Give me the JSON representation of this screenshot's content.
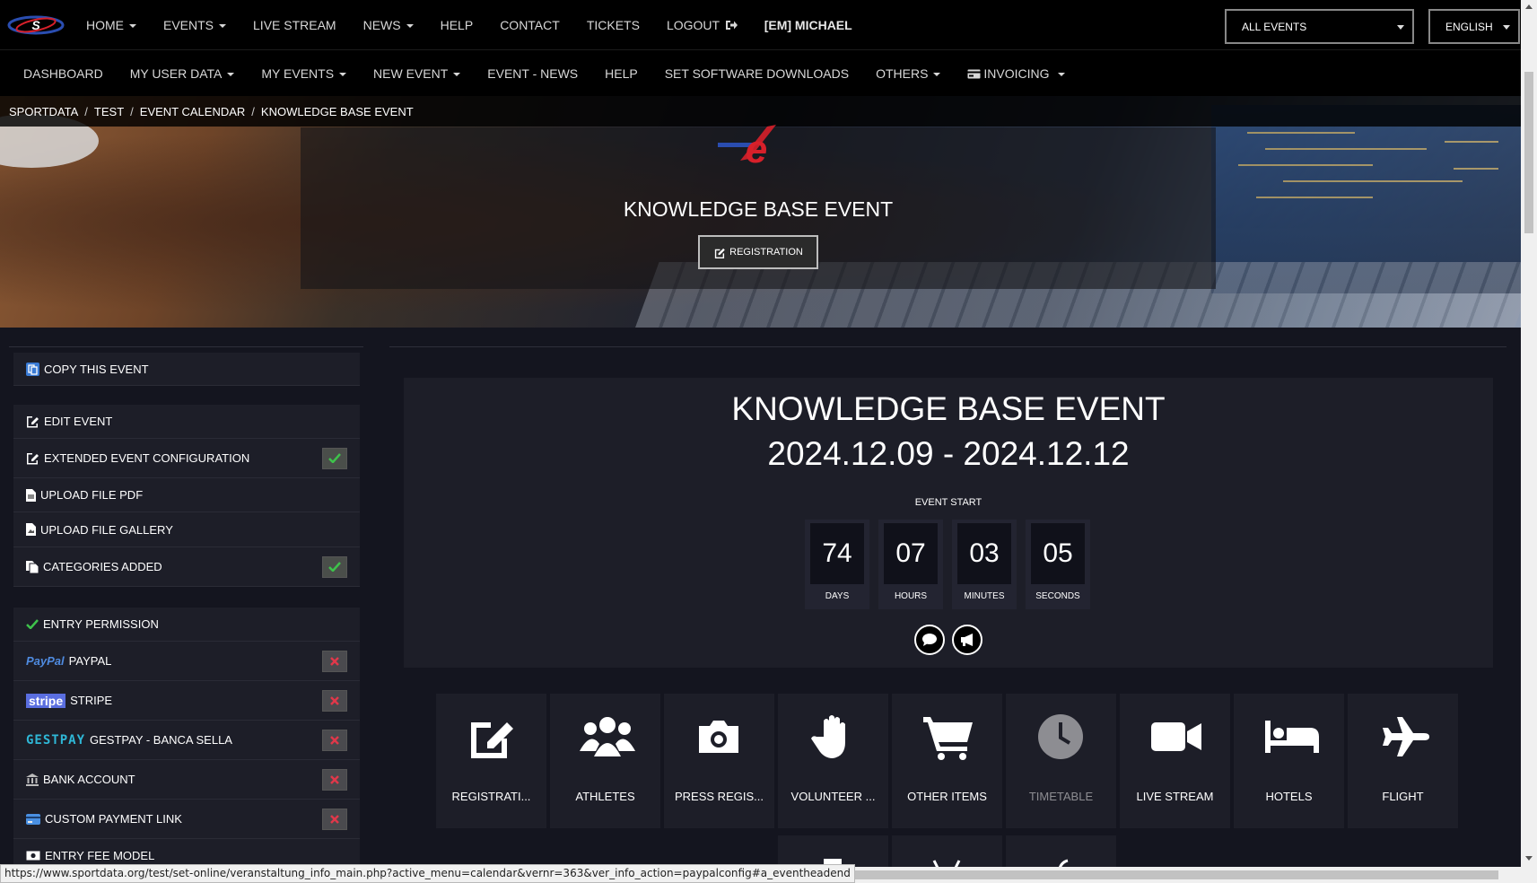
{
  "topnav": {
    "items": [
      {
        "label": "HOME",
        "dropdown": true
      },
      {
        "label": "EVENTS",
        "dropdown": true
      },
      {
        "label": "LIVE STREAM",
        "dropdown": false
      },
      {
        "label": "NEWS",
        "dropdown": true
      },
      {
        "label": "HELP",
        "dropdown": false
      },
      {
        "label": "CONTACT",
        "dropdown": false
      },
      {
        "label": "TICKETS",
        "dropdown": false
      },
      {
        "label": "LOGOUT",
        "dropdown": false,
        "icon": "sign-out-icon"
      }
    ],
    "user": "[EM] MICHAEL",
    "event_select": "ALL EVENTS",
    "language_select": "ENGLISH"
  },
  "subnav": {
    "items": [
      {
        "label": "DASHBOARD",
        "dropdown": false
      },
      {
        "label": "MY USER DATA",
        "dropdown": true
      },
      {
        "label": "MY EVENTS",
        "dropdown": true
      },
      {
        "label": "NEW EVENT",
        "dropdown": true
      },
      {
        "label": "EVENT - NEWS",
        "dropdown": false
      },
      {
        "label": "HELP",
        "dropdown": false
      },
      {
        "label": "SET SOFTWARE DOWNLOADS",
        "dropdown": false
      },
      {
        "label": "OTHERS",
        "dropdown": true
      },
      {
        "label": "INVOICING",
        "dropdown": true,
        "icon": "credit-card-icon"
      }
    ]
  },
  "breadcrumb": [
    "SPORTDATA",
    "TEST",
    "EVENT CALENDAR",
    "KNOWLEDGE BASE EVENT"
  ],
  "hero": {
    "title": "KNOWLEDGE BASE EVENT",
    "registration_button": "REGISTRATION"
  },
  "sidebar": {
    "items": [
      {
        "label": "COPY THIS EVENT",
        "icon": "copy-icon",
        "status": null
      },
      {
        "label": "EDIT EVENT",
        "icon": "edit-icon",
        "status": null
      },
      {
        "label": "EXTENDED EVENT CONFIGURATION",
        "icon": "edit-icon",
        "status": "ok"
      },
      {
        "label": "UPLOAD FILE PDF",
        "icon": "file-pdf-icon",
        "status": null
      },
      {
        "label": "UPLOAD FILE GALLERY",
        "icon": "file-image-icon",
        "status": null
      },
      {
        "label": "CATEGORIES ADDED",
        "icon": "files-icon",
        "status": "ok"
      },
      {
        "label": "ENTRY PERMISSION",
        "icon": "check-icon",
        "status": null
      },
      {
        "label": "PAYPAL",
        "icon": "paypal-logo",
        "logo_text": "PayPal",
        "status": "no"
      },
      {
        "label": "STRIPE",
        "icon": "stripe-logo",
        "logo_text": "stripe",
        "status": "no"
      },
      {
        "label": "GESTPAY - BANCA SELLA",
        "icon": "gestpay-logo",
        "logo_text": "GESTPAY",
        "status": "no"
      },
      {
        "label": "BANK ACCOUNT",
        "icon": "bank-icon",
        "status": "no"
      },
      {
        "label": "CUSTOM PAYMENT LINK",
        "icon": "credit-card-icon",
        "status": "no"
      },
      {
        "label": "ENTRY FEE MODEL",
        "icon": "money-icon",
        "status": null
      }
    ]
  },
  "event": {
    "title": "KNOWLEDGE BASE EVENT",
    "dates": "2024.12.09 - 2024.12.12",
    "countdown_label": "EVENT START",
    "countdown": [
      {
        "value": "74",
        "unit": "DAYS"
      },
      {
        "value": "07",
        "unit": "HOURS"
      },
      {
        "value": "03",
        "unit": "MINUTES"
      },
      {
        "value": "05",
        "unit": "SECONDS"
      }
    ]
  },
  "tiles": [
    {
      "label": "REGISTRATI...",
      "icon": "edit-icon",
      "disabled": false
    },
    {
      "label": "ATHLETES",
      "icon": "users-icon",
      "disabled": false
    },
    {
      "label": "PRESS REGIS...",
      "icon": "camera-icon",
      "disabled": false
    },
    {
      "label": "VOLUNTEER ...",
      "icon": "hand-icon",
      "disabled": false
    },
    {
      "label": "OTHER ITEMS",
      "icon": "shopping-cart-icon",
      "disabled": false
    },
    {
      "label": "TIMETABLE",
      "icon": "clock-icon",
      "disabled": true
    },
    {
      "label": "LIVE STREAM",
      "icon": "video-camera-icon",
      "disabled": false
    },
    {
      "label": "HOTELS",
      "icon": "bed-icon",
      "disabled": false
    },
    {
      "label": "FLIGHT",
      "icon": "plane-icon",
      "disabled": false
    }
  ],
  "status_url": "https://www.sportdata.org/test/set-online/veranstaltung_info_main.php?active_menu=calendar&vernr=363&ver_info_action=paypalconfig#a_eventheadend",
  "colors": {
    "ok": "#3ec24b",
    "no": "#e0384a",
    "brand_red": "#d7202a",
    "brand_blue": "#2a4db0"
  }
}
